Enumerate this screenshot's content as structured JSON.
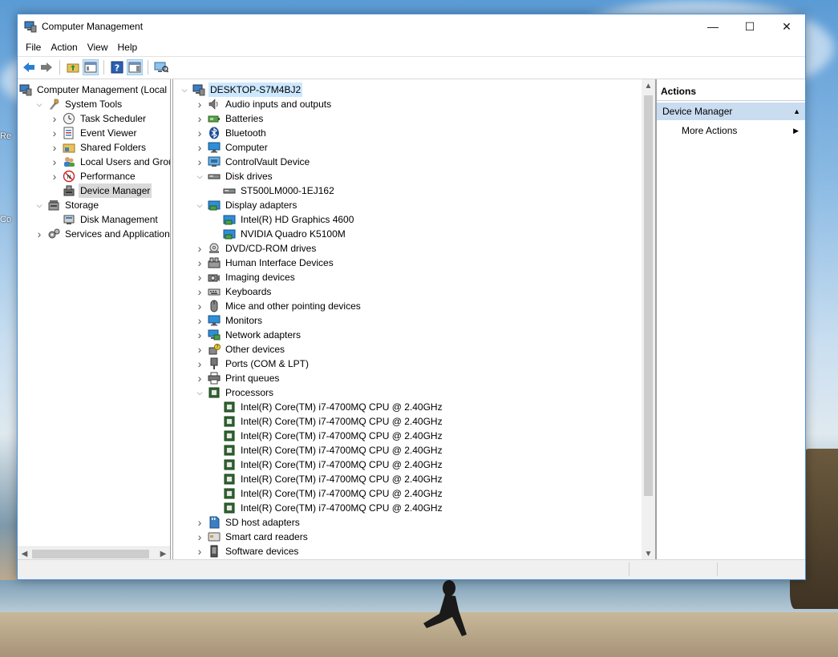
{
  "window": {
    "title": "Computer Management",
    "controls": {
      "minimize": "—",
      "maximize": "☐",
      "close": "✕"
    }
  },
  "menu": [
    "File",
    "Action",
    "View",
    "Help"
  ],
  "left_tree": [
    {
      "label": "Computer Management (Local",
      "level": 0,
      "expander": "",
      "icon": "computer-management-icon"
    },
    {
      "label": "System Tools",
      "level": 1,
      "expander": "open",
      "icon": "system-tools-icon"
    },
    {
      "label": "Task Scheduler",
      "level": 2,
      "expander": "closed",
      "icon": "clock-icon"
    },
    {
      "label": "Event Viewer",
      "level": 2,
      "expander": "closed",
      "icon": "event-viewer-icon"
    },
    {
      "label": "Shared Folders",
      "level": 2,
      "expander": "closed",
      "icon": "shared-folder-icon"
    },
    {
      "label": "Local Users and Groups",
      "level": 2,
      "expander": "closed",
      "icon": "users-icon"
    },
    {
      "label": "Performance",
      "level": 2,
      "expander": "closed",
      "icon": "performance-icon"
    },
    {
      "label": "Device Manager",
      "level": 2,
      "expander": "",
      "icon": "device-manager-icon",
      "selected": true
    },
    {
      "label": "Storage",
      "level": 1,
      "expander": "open",
      "icon": "storage-icon"
    },
    {
      "label": "Disk Management",
      "level": 2,
      "expander": "",
      "icon": "disk-management-icon"
    },
    {
      "label": "Services and Applications",
      "level": 1,
      "expander": "closed",
      "icon": "services-icon"
    }
  ],
  "device_tree": [
    {
      "label": "DESKTOP-S7M4BJ2",
      "level": 0,
      "expander": "open",
      "icon": "computer-root-icon",
      "root": true
    },
    {
      "label": "Audio inputs and outputs",
      "level": 1,
      "expander": "closed",
      "icon": "speaker-icon"
    },
    {
      "label": "Batteries",
      "level": 1,
      "expander": "closed",
      "icon": "battery-icon"
    },
    {
      "label": "Bluetooth",
      "level": 1,
      "expander": "closed",
      "icon": "bluetooth-icon"
    },
    {
      "label": "Computer",
      "level": 1,
      "expander": "closed",
      "icon": "monitor-icon"
    },
    {
      "label": "ControlVault Device",
      "level": 1,
      "expander": "closed",
      "icon": "controlvault-icon"
    },
    {
      "label": "Disk drives",
      "level": 1,
      "expander": "open",
      "icon": "disk-drive-icon"
    },
    {
      "label": "ST500LM000-1EJ162",
      "level": 2,
      "expander": "",
      "icon": "disk-drive-icon"
    },
    {
      "label": "Display adapters",
      "level": 1,
      "expander": "open",
      "icon": "display-adapter-icon"
    },
    {
      "label": "Intel(R) HD Graphics 4600",
      "level": 2,
      "expander": "",
      "icon": "display-adapter-icon"
    },
    {
      "label": "NVIDIA Quadro K5100M",
      "level": 2,
      "expander": "",
      "icon": "display-adapter-icon"
    },
    {
      "label": "DVD/CD-ROM drives",
      "level": 1,
      "expander": "closed",
      "icon": "dvd-icon"
    },
    {
      "label": "Human Interface Devices",
      "level": 1,
      "expander": "closed",
      "icon": "hid-icon"
    },
    {
      "label": "Imaging devices",
      "level": 1,
      "expander": "closed",
      "icon": "camera-icon"
    },
    {
      "label": "Keyboards",
      "level": 1,
      "expander": "closed",
      "icon": "keyboard-icon"
    },
    {
      "label": "Mice and other pointing devices",
      "level": 1,
      "expander": "closed",
      "icon": "mouse-icon"
    },
    {
      "label": "Monitors",
      "level": 1,
      "expander": "closed",
      "icon": "monitor-icon"
    },
    {
      "label": "Network adapters",
      "level": 1,
      "expander": "closed",
      "icon": "network-icon"
    },
    {
      "label": "Other devices",
      "level": 1,
      "expander": "closed",
      "icon": "unknown-device-icon"
    },
    {
      "label": "Ports (COM & LPT)",
      "level": 1,
      "expander": "closed",
      "icon": "port-icon"
    },
    {
      "label": "Print queues",
      "level": 1,
      "expander": "closed",
      "icon": "printer-icon"
    },
    {
      "label": "Processors",
      "level": 1,
      "expander": "open",
      "icon": "processor-icon"
    },
    {
      "label": "Intel(R) Core(TM) i7-4700MQ CPU @ 2.40GHz",
      "level": 2,
      "expander": "",
      "icon": "processor-icon"
    },
    {
      "label": "Intel(R) Core(TM) i7-4700MQ CPU @ 2.40GHz",
      "level": 2,
      "expander": "",
      "icon": "processor-icon"
    },
    {
      "label": "Intel(R) Core(TM) i7-4700MQ CPU @ 2.40GHz",
      "level": 2,
      "expander": "",
      "icon": "processor-icon"
    },
    {
      "label": "Intel(R) Core(TM) i7-4700MQ CPU @ 2.40GHz",
      "level": 2,
      "expander": "",
      "icon": "processor-icon"
    },
    {
      "label": "Intel(R) Core(TM) i7-4700MQ CPU @ 2.40GHz",
      "level": 2,
      "expander": "",
      "icon": "processor-icon"
    },
    {
      "label": "Intel(R) Core(TM) i7-4700MQ CPU @ 2.40GHz",
      "level": 2,
      "expander": "",
      "icon": "processor-icon"
    },
    {
      "label": "Intel(R) Core(TM) i7-4700MQ CPU @ 2.40GHz",
      "level": 2,
      "expander": "",
      "icon": "processor-icon"
    },
    {
      "label": "Intel(R) Core(TM) i7-4700MQ CPU @ 2.40GHz",
      "level": 2,
      "expander": "",
      "icon": "processor-icon"
    },
    {
      "label": "SD host adapters",
      "level": 1,
      "expander": "closed",
      "icon": "sd-card-icon"
    },
    {
      "label": "Smart card readers",
      "level": 1,
      "expander": "closed",
      "icon": "smart-card-icon"
    },
    {
      "label": "Software devices",
      "level": 1,
      "expander": "closed",
      "icon": "software-device-icon"
    }
  ],
  "actions": {
    "header": "Actions",
    "section": "Device Manager",
    "item": "More Actions"
  },
  "desktop_fragments": [
    "Re",
    "Co"
  ],
  "colors": {
    "accent": "#4a90d9",
    "selection": "#cce8ff",
    "actions_section": "#c9dcf0"
  }
}
